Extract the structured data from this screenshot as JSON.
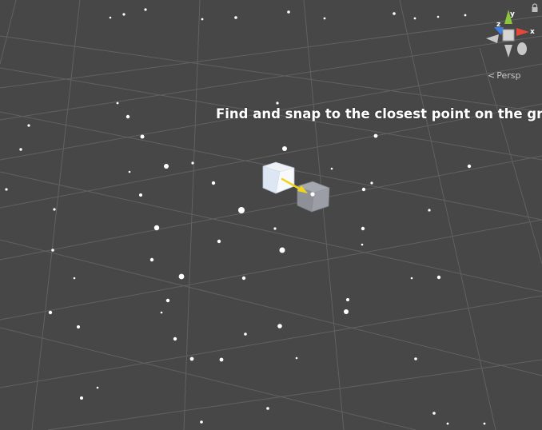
{
  "scene_view": {
    "caption": "Find and snap to the closest point on the grid",
    "projection_label": "Persp",
    "projection_glyph": "<",
    "gizmo_axes": {
      "x": "x",
      "y": "y",
      "z": "z"
    },
    "colors": {
      "background": "#474747",
      "grid_line": "#626262",
      "vertex_dot": "#ffffff",
      "arrow": "#f2d41a",
      "axis_x": "#e8483a",
      "axis_y": "#8ac73a",
      "axis_z": "#3d7fe0"
    }
  }
}
